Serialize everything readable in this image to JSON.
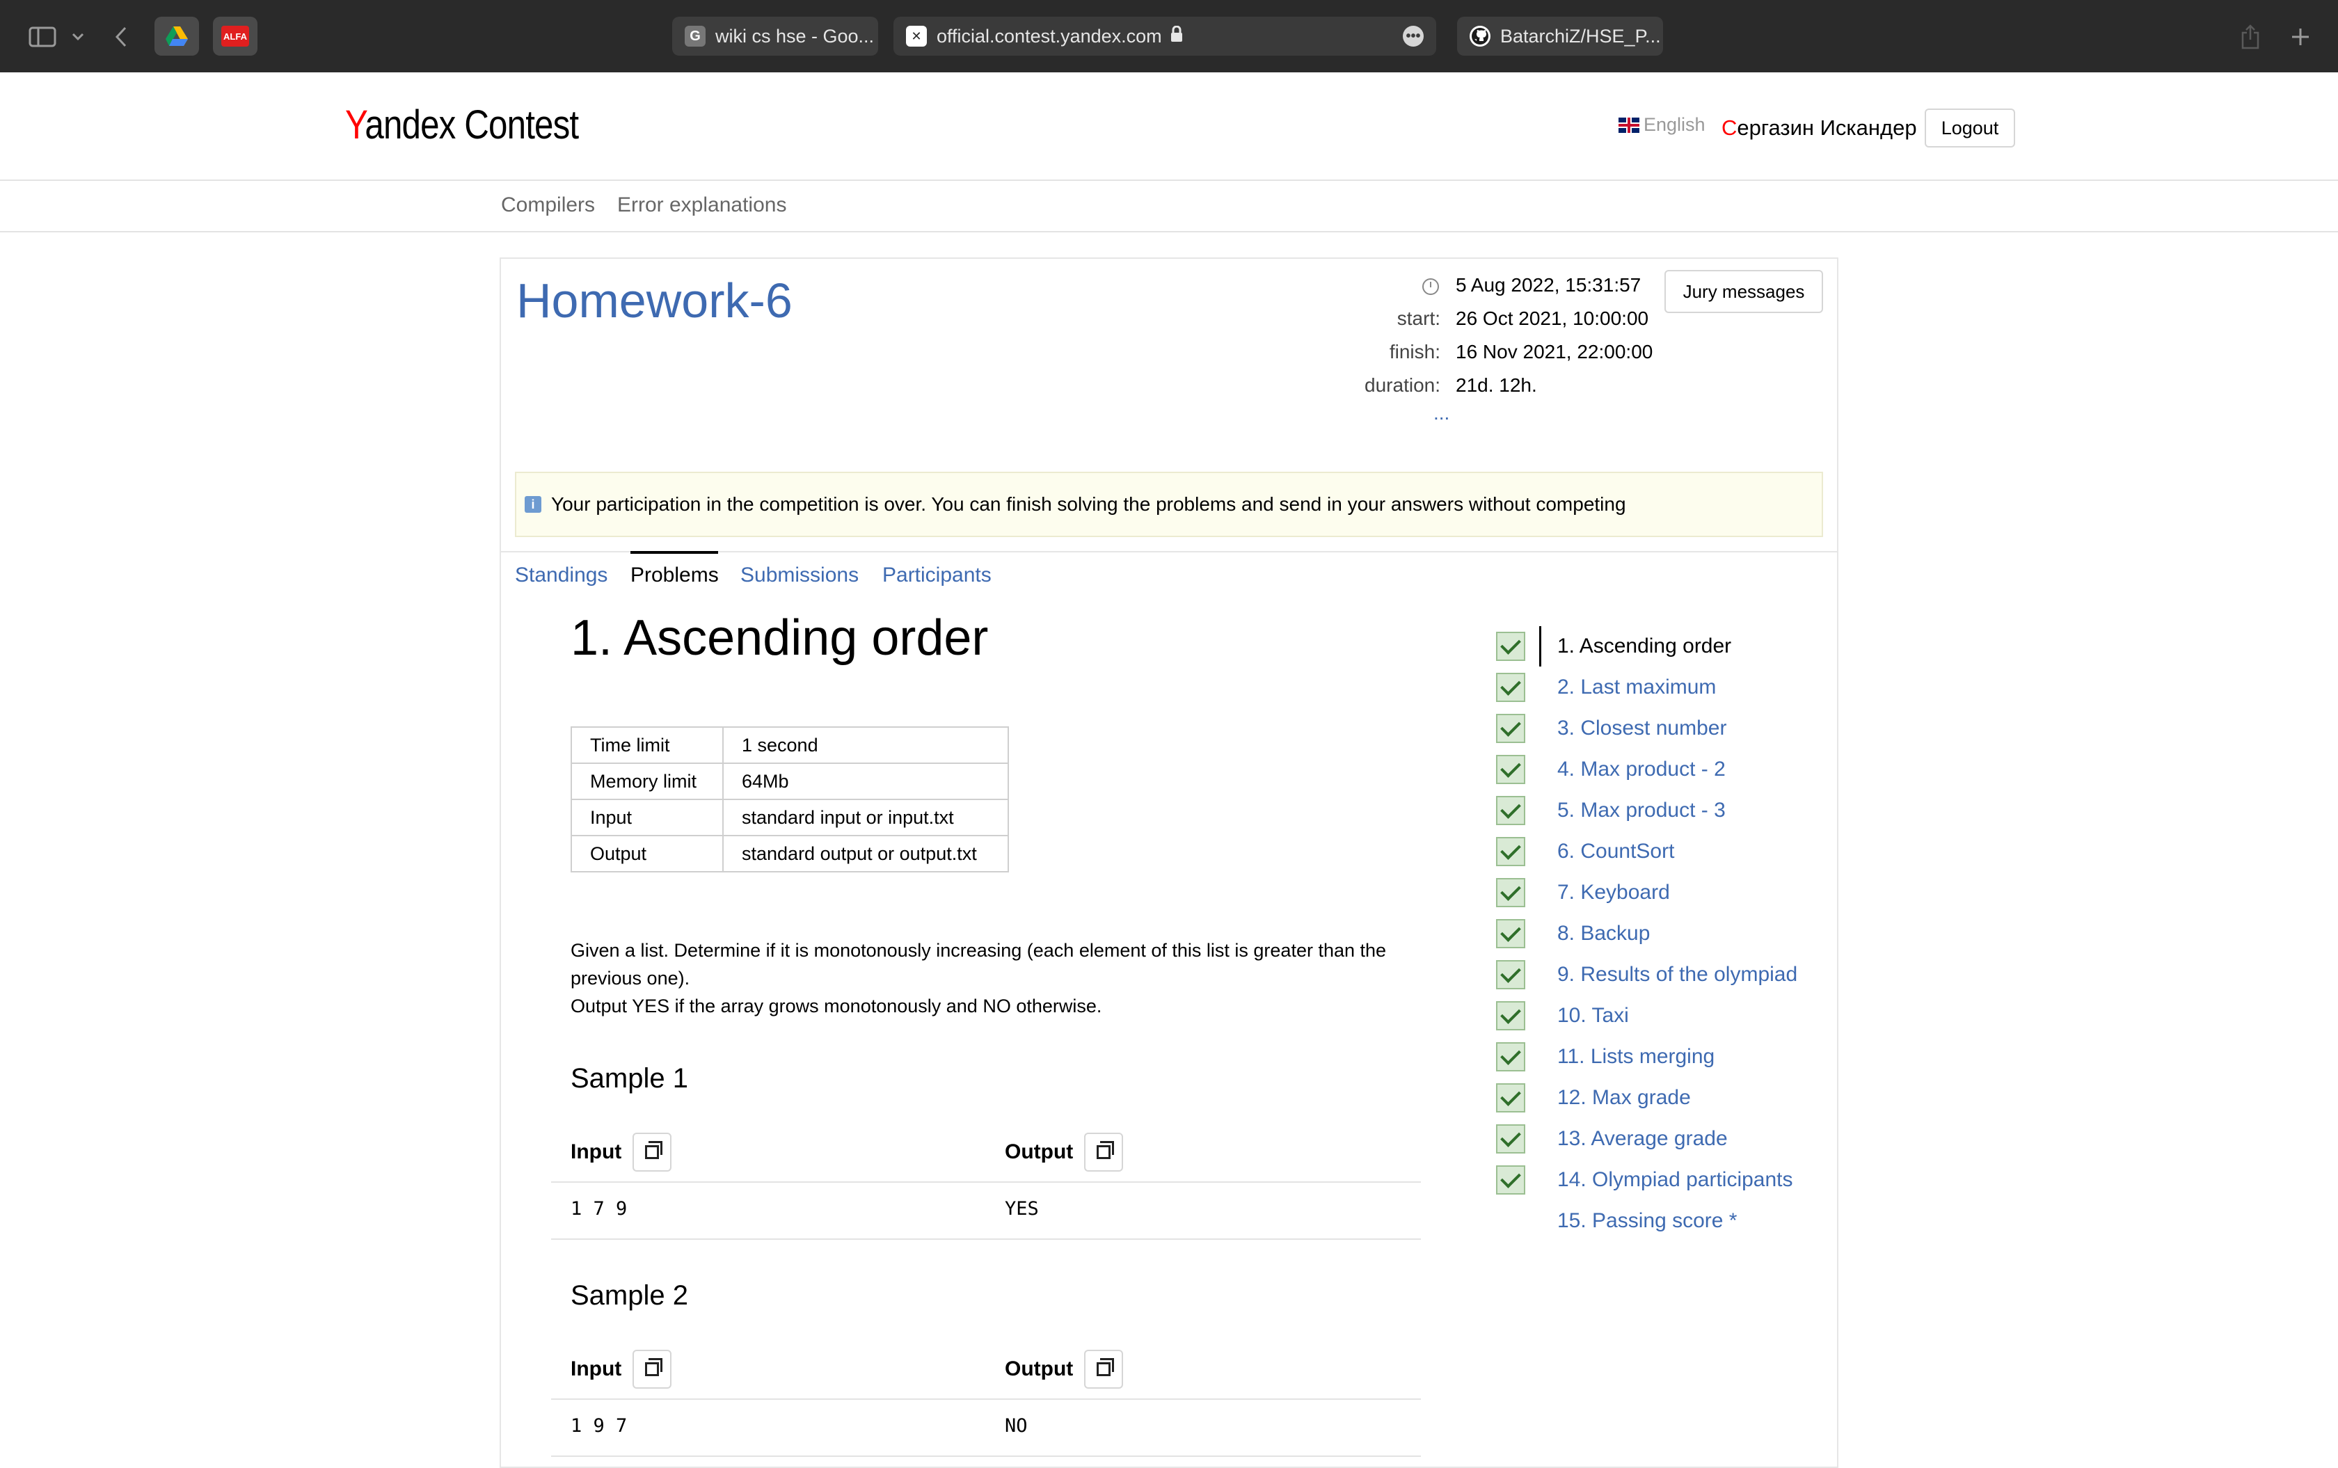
{
  "browser": {
    "tabs": [
      {
        "label": "wiki cs hse - Goo...",
        "favicon": "G"
      },
      {
        "label": "official.contest.yandex.com",
        "favicon": "Y"
      },
      {
        "label": "BatarchiZ/HSE_P...",
        "favicon": "GH"
      }
    ]
  },
  "header": {
    "logo_first": "Y",
    "logo_rest": "andex Contest",
    "language": "English",
    "user_first": "С",
    "user_rest": "ергазин Искандер",
    "logout": "Logout"
  },
  "subnav": {
    "items": [
      "Compilers",
      "Error explanations"
    ]
  },
  "contest": {
    "title": "Homework-6",
    "now": "5 Aug 2022, 15:31:57",
    "start_label": "start:",
    "start": "26 Oct 2021, 10:00:00",
    "finish_label": "finish:",
    "finish": "16 Nov 2021, 22:00:00",
    "duration_label": "duration:",
    "duration": "21d. 12h.",
    "more": "...",
    "jury_button": "Jury messages",
    "notice": "Your participation in the competition is over. You can finish solving the problems and send in your answers without competing",
    "tabs": [
      "Standings",
      "Problems",
      "Submissions",
      "Participants"
    ]
  },
  "problem": {
    "title": "1. Ascending order",
    "limits": [
      {
        "key": "Time limit",
        "value": "1 second"
      },
      {
        "key": "Memory limit",
        "value": "64Mb"
      },
      {
        "key": "Input",
        "value": "standard input or input.txt"
      },
      {
        "key": "Output",
        "value": "standard output or output.txt"
      }
    ],
    "statement_1": "Given a list. Determine if it is monotonously increasing (each element of this list is greater than the previous one).",
    "statement_2": "Output YES if the array grows monotonously and NO otherwise.",
    "samples": [
      {
        "title": "Sample 1",
        "input_label": "Input",
        "output_label": "Output",
        "input": "1 7 9",
        "output": "YES"
      },
      {
        "title": "Sample 2",
        "input_label": "Input",
        "output_label": "Output",
        "input": "1 9 7",
        "output": "NO"
      }
    ]
  },
  "problem_list": [
    {
      "name": "1. Ascending order",
      "solved": true
    },
    {
      "name": "2. Last maximum",
      "solved": true
    },
    {
      "name": "3. Closest number",
      "solved": true
    },
    {
      "name": "4. Max product - 2",
      "solved": true
    },
    {
      "name": "5. Max product - 3",
      "solved": true
    },
    {
      "name": "6. CountSort",
      "solved": true
    },
    {
      "name": "7. Keyboard",
      "solved": true
    },
    {
      "name": "8. Backup",
      "solved": true
    },
    {
      "name": "9. Results of the olympiad",
      "solved": true
    },
    {
      "name": "10. Taxi",
      "solved": true
    },
    {
      "name": "11. Lists merging",
      "solved": true
    },
    {
      "name": "12. Max grade",
      "solved": true
    },
    {
      "name": "13. Average grade",
      "solved": true
    },
    {
      "name": "14. Olympiad participants",
      "solved": true
    },
    {
      "name": "15. Passing score *",
      "solved": false
    }
  ],
  "colors": {
    "link": "#3e6ab1",
    "logo_accent": "#ff0000",
    "notice_bg": "#fdfdee"
  }
}
